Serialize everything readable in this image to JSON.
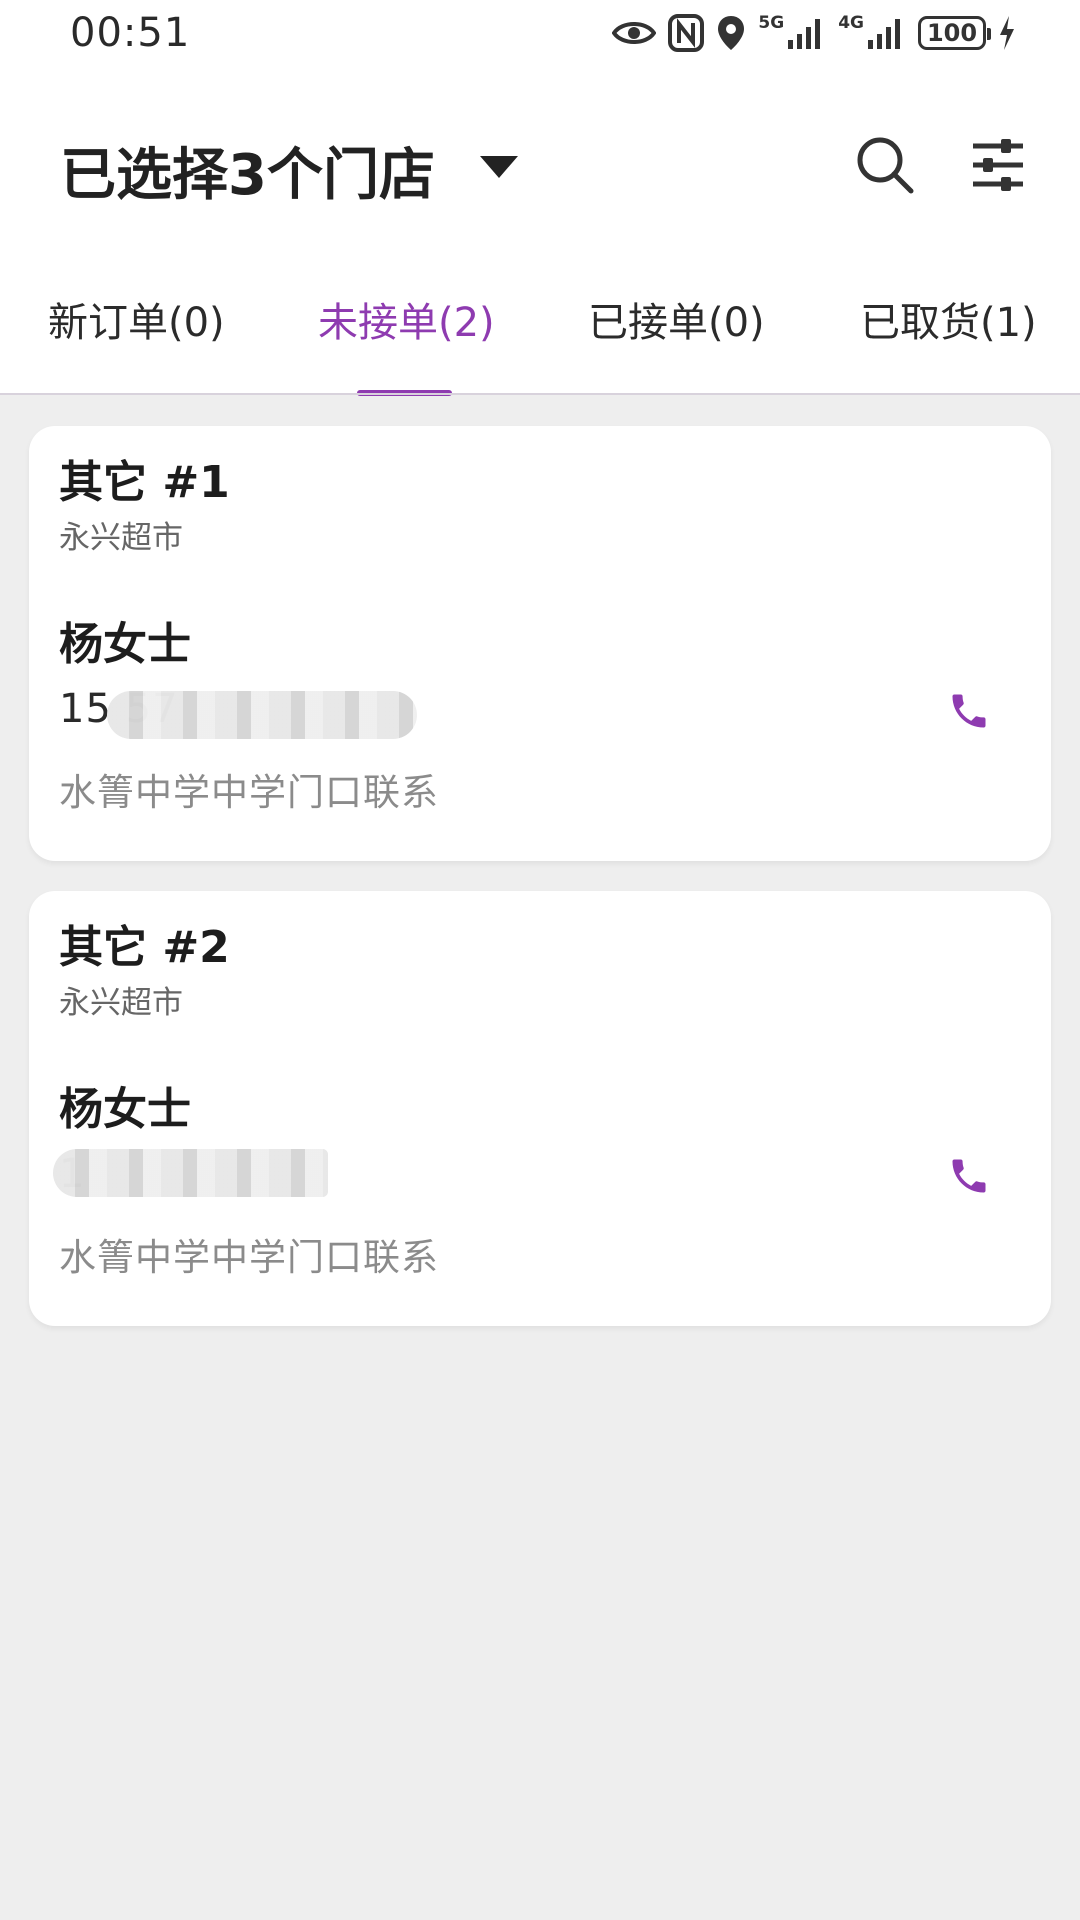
{
  "status_bar": {
    "time": "00:51",
    "signal_5g": "5G",
    "signal_4g": "4G",
    "battery": "100"
  },
  "header": {
    "title": "已选择3个门店"
  },
  "tabs": [
    {
      "label": "新订单(0)",
      "active": false
    },
    {
      "label": "未接单(2)",
      "active": true
    },
    {
      "label": "已接单(0)",
      "active": false
    },
    {
      "label": "已取货(1)",
      "active": false
    }
  ],
  "orders": [
    {
      "title": "其它 #1",
      "store": "永兴超市",
      "customer": "杨女士",
      "phone": "15                    57",
      "address": "水箐中学中学门口联系"
    },
    {
      "title": "其它 #2",
      "store": "永兴超市",
      "customer": "杨女士",
      "phone": "1",
      "address": "水箐中学中学门口联系"
    }
  ],
  "colors": {
    "accent": "#8e3bb0",
    "background": "#eeeeee",
    "card": "#ffffff"
  },
  "icons": [
    "eye-icon",
    "nfc-icon",
    "location-icon",
    "signal-icon",
    "battery-icon",
    "charging-icon",
    "dropdown-arrow-icon",
    "search-icon",
    "filter-icon",
    "phone-icon"
  ]
}
